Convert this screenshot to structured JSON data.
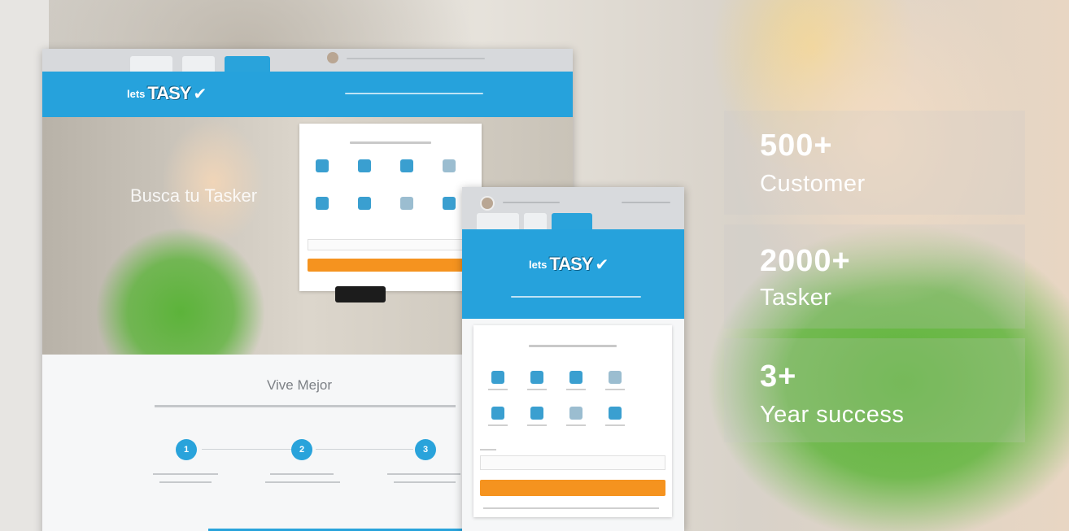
{
  "mockup": {
    "hero_text": "Busca tu Tasker",
    "section_title": "Vive Mejor",
    "steps": [
      "1",
      "2",
      "3"
    ]
  },
  "stats": [
    {
      "number": "500+",
      "label": "Customer"
    },
    {
      "number": "2000+",
      "label": "Tasker"
    },
    {
      "number": "3+",
      "label": "Year success"
    }
  ],
  "colors": {
    "brand_blue": "#26a2dc",
    "accent_orange": "#f5931f",
    "shirt_green": "#5fb53b"
  },
  "icons": [
    "wrench-icon",
    "car-icon",
    "tools-icon",
    "cleaning-icon",
    "paint-roller-icon",
    "moving-icon",
    "garden-icon",
    "plumbing-icon"
  ]
}
